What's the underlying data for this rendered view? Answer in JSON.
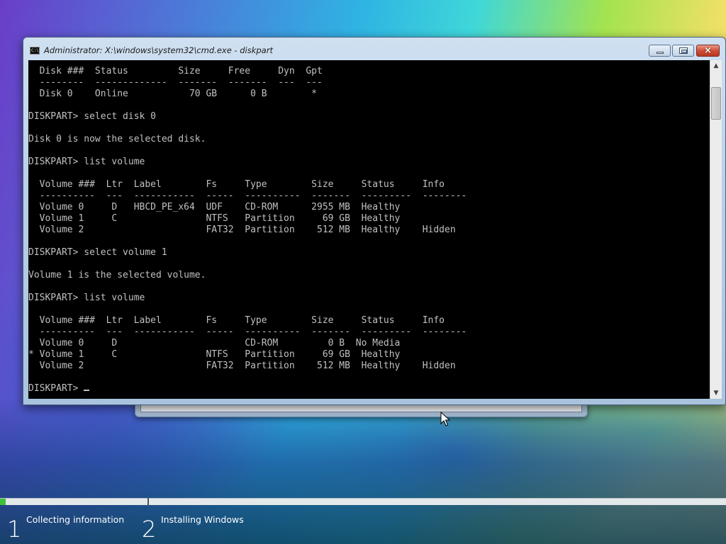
{
  "setup": {
    "steps": [
      {
        "number": "1",
        "label": "Collecting information"
      },
      {
        "number": "2",
        "label": "Installing Windows"
      }
    ],
    "progress_fraction": 0.04,
    "progress_color": "#3fbf3a"
  },
  "cmd_window": {
    "title": "Administrator: X:\\windows\\system32\\cmd.exe - diskpart",
    "icon": "cmd-icon",
    "buttons": {
      "minimize": "minimize-icon",
      "maximize": "maximize-icon",
      "close": "×"
    },
    "console_text": "  Disk ###  Status         Size     Free     Dyn  Gpt\n  --------  -------------  -------  -------  ---  ---\n  Disk 0    Online           70 GB      0 B        *\n\nDISKPART> select disk 0\n\nDisk 0 is now the selected disk.\n\nDISKPART> list volume\n\n  Volume ###  Ltr  Label        Fs     Type        Size     Status     Info\n  ----------  ---  -----------  -----  ----------  -------  ---------  --------\n  Volume 0     D   HBCD_PE_x64  UDF    CD-ROM      2955 MB  Healthy\n  Volume 1     C                NTFS   Partition     69 GB  Healthy\n  Volume 2                      FAT32  Partition    512 MB  Healthy    Hidden\n\nDISKPART> select volume 1\n\nVolume 1 is the selected volume.\n\nDISKPART> list volume\n\n  Volume ###  Ltr  Label        Fs     Type        Size     Status     Info\n  ----------  ---  -----------  -----  ----------  -------  ---------  --------\n  Volume 0     D                       CD-ROM         0 B  No Media\n* Volume 1     C                NTFS   Partition     69 GB  Healthy\n  Volume 2                      FAT32  Partition    512 MB  Healthy    Hidden\n\nDISKPART> ",
    "scrollbar": {
      "up": "▲",
      "down": "▼"
    }
  }
}
